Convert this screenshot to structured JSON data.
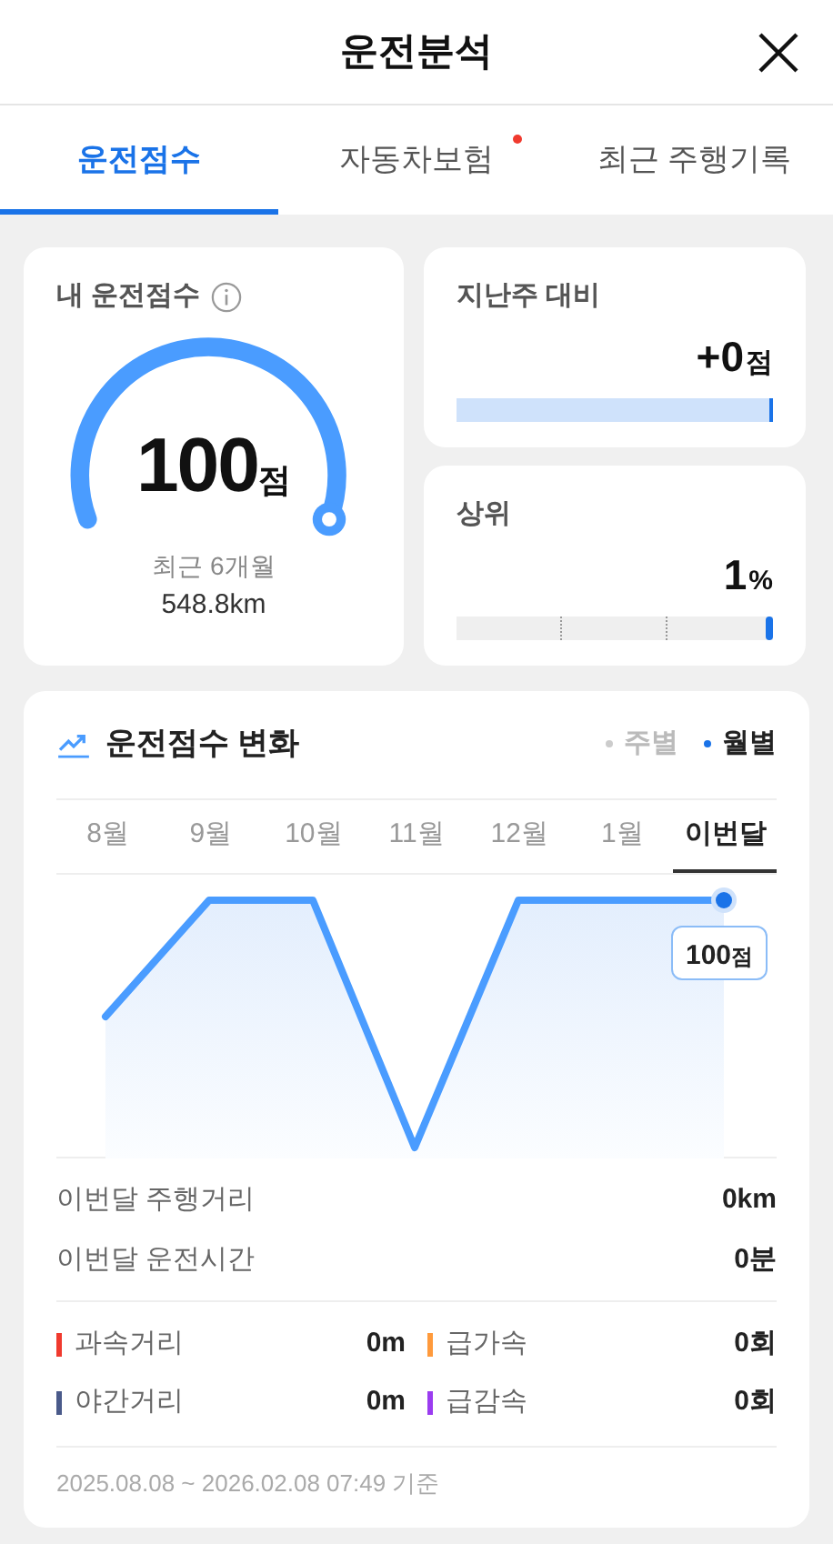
{
  "header": {
    "title": "운전분석"
  },
  "tabs": [
    {
      "label": "운전점수",
      "selected": true,
      "badge": false
    },
    {
      "label": "자동차보험",
      "selected": false,
      "badge": true
    },
    {
      "label": "최근 주행기록",
      "selected": false,
      "badge": false
    }
  ],
  "score_card": {
    "title": "내 운전점수",
    "score": "100",
    "unit": "점",
    "period": "최근 6개월",
    "distance": "548.8km"
  },
  "compare_card": {
    "title": "지난주 대비",
    "value": "+0",
    "unit": "점",
    "level": 1
  },
  "rank_card": {
    "title": "상위",
    "value": "1",
    "unit": "%",
    "level": 1
  },
  "trend": {
    "title": "운전점수 변화",
    "periods": [
      {
        "label": "주별",
        "selected": false
      },
      {
        "label": "월별",
        "selected": true
      }
    ],
    "months": [
      {
        "label": "8월",
        "selected": false
      },
      {
        "label": "9월",
        "selected": false
      },
      {
        "label": "10월",
        "selected": false
      },
      {
        "label": "11월",
        "selected": false
      },
      {
        "label": "12월",
        "selected": false
      },
      {
        "label": "1월",
        "selected": false
      },
      {
        "label": "이번달",
        "selected": true
      }
    ],
    "callout": {
      "value": "100",
      "unit": "점"
    },
    "summary": [
      {
        "label": "이번달 주행거리",
        "value": "0km"
      },
      {
        "label": "이번달 운전시간",
        "value": "0분"
      }
    ],
    "stats": [
      {
        "label": "과속거리",
        "value": "0m",
        "color": "#f03a2e"
      },
      {
        "label": "급가속",
        "value": "0회",
        "color": "#ff9a3c"
      },
      {
        "label": "야간거리",
        "value": "0m",
        "color": "#4a5a8a"
      },
      {
        "label": "급감속",
        "value": "0회",
        "color": "#9b3cf0"
      }
    ],
    "footnote": "2025.08.08 ~ 2026.02.08 07:49 기준"
  }
}
